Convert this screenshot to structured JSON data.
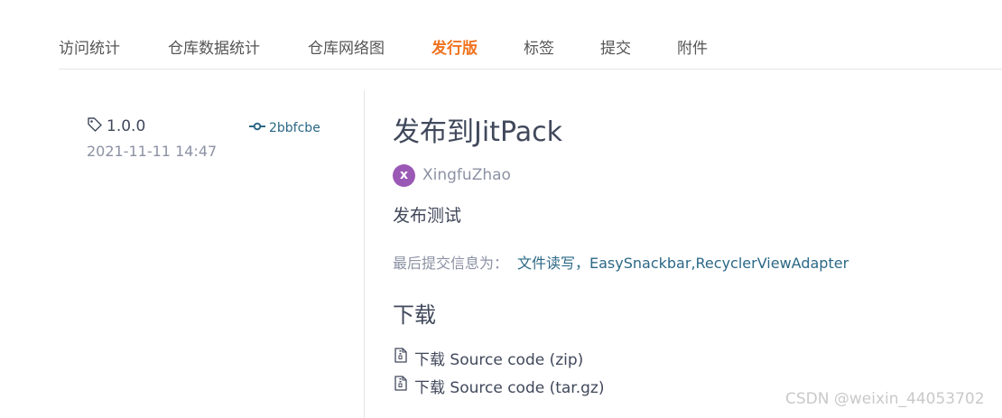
{
  "tabs": [
    {
      "label": "访问统计",
      "active": false
    },
    {
      "label": "仓库数据统计",
      "active": false
    },
    {
      "label": "仓库网络图",
      "active": false
    },
    {
      "label": "发行版",
      "active": true
    },
    {
      "label": "标签",
      "active": false
    },
    {
      "label": "提交",
      "active": false
    },
    {
      "label": "附件",
      "active": false
    }
  ],
  "release": {
    "tag": "1.0.0",
    "commit": "2bbfcbe",
    "date": "2021-11-11 14:47",
    "title": "发布到JitPack",
    "author": {
      "initial": "x",
      "name": "XingfuZhao",
      "avatar_color": "#9b59b6"
    },
    "description": "发布测试",
    "last_commit_label": "最后提交信息为：",
    "last_commit_message": "文件读写，EasySnackbar,RecyclerViewAdapter"
  },
  "downloads": {
    "title": "下载",
    "items": [
      {
        "label": "下载 Source code (zip)"
      },
      {
        "label": "下载 Source code (tar.gz)"
      }
    ]
  },
  "watermark": "CSDN @weixin_44053702",
  "colors": {
    "accent": "#f0731f",
    "link": "#2b6887",
    "muted": "#8c92a4"
  }
}
